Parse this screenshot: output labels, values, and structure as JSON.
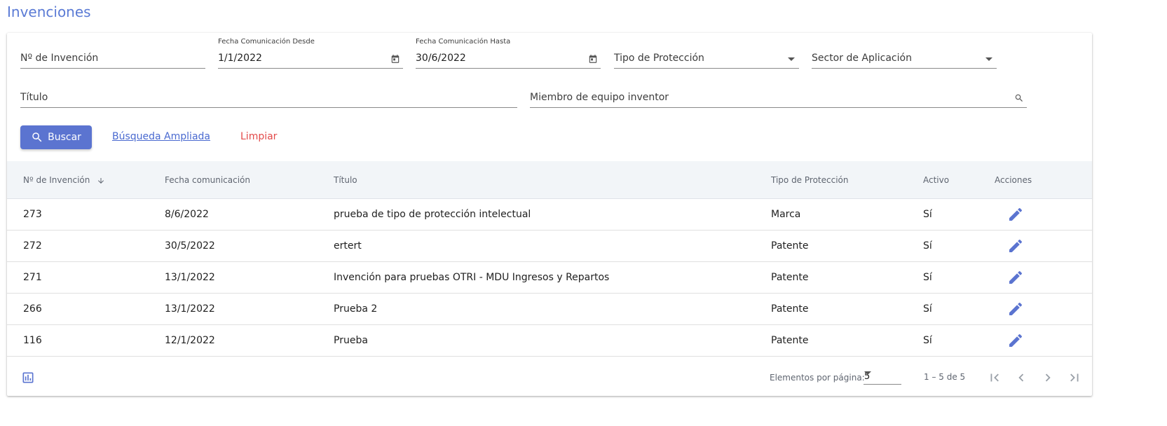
{
  "page": {
    "title": "Invenciones"
  },
  "filters": {
    "invention_number_placeholder": "Nº de Invención",
    "date_from_label": "Fecha Comunicación Desde",
    "date_from_value": "1/1/2022",
    "date_to_label": "Fecha Comunicación Hasta",
    "date_to_value": "30/6/2022",
    "protection_type_placeholder": "Tipo de Protección",
    "sector_placeholder": "Sector de Aplicación",
    "title_placeholder": "Título",
    "team_member_placeholder": "Miembro de equipo inventor"
  },
  "actions": {
    "search_label": "Buscar",
    "advanced_search_label": "Búsqueda Ampliada",
    "clear_label": "Limpiar"
  },
  "table": {
    "headers": [
      "Nº de Invención",
      "Fecha comunicación",
      "Título",
      "Tipo de Protección",
      "Activo",
      "Acciones"
    ],
    "rows": [
      [
        "273",
        "8/6/2022",
        "prueba de tipo de protección intelectual",
        "Marca",
        "Sí"
      ],
      [
        "272",
        "30/5/2022",
        "ertert",
        "Patente",
        "Sí"
      ],
      [
        "271",
        "13/1/2022",
        "Invención para pruebas OTRI - MDU Ingresos y Repartos",
        "Patente",
        "Sí"
      ],
      [
        "266",
        "13/1/2022",
        "Prueba 2",
        "Patente",
        "Sí"
      ],
      [
        "116",
        "12/1/2022",
        "Prueba",
        "Patente",
        "Sí"
      ]
    ]
  },
  "paginator": {
    "items_per_page_label": "Elementos por página:",
    "items_per_page_value": "5",
    "range_label": "1 – 5 de 5"
  },
  "icons": {
    "calendar": "calendar-icon",
    "search": "search-icon",
    "edit": "edit-icon",
    "chart": "bar-chart-icon",
    "sort": "arrow-down-icon",
    "first_page": "first-page-icon",
    "prev_page": "chevron-left-icon",
    "next_page": "chevron-right-icon",
    "last_page": "last-page-icon"
  },
  "colors": {
    "accent": "#5b74d0",
    "title": "#5b7bd5",
    "clear": "#e34a4a"
  }
}
